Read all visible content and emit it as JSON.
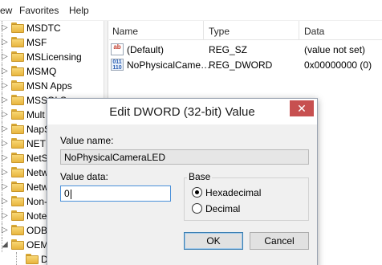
{
  "menu": {
    "items": [
      "ew",
      "Favorites",
      "Help"
    ]
  },
  "tree": {
    "items": [
      {
        "label": "MSDTC",
        "arrow": "▷"
      },
      {
        "label": "MSF",
        "arrow": "▷"
      },
      {
        "label": "MSLicensing",
        "arrow": "▷"
      },
      {
        "label": "MSMQ",
        "arrow": "▷"
      },
      {
        "label": "MSN Apps",
        "arrow": "▷"
      },
      {
        "label": "MSSQLS",
        "arrow": "▷"
      },
      {
        "label": "Mult",
        "arrow": "▷"
      },
      {
        "label": "NapS",
        "arrow": "▷"
      },
      {
        "label": "NET",
        "arrow": "▷"
      },
      {
        "label": "NetS",
        "arrow": "▷"
      },
      {
        "label": "Netw",
        "arrow": "▷"
      },
      {
        "label": "Netw",
        "arrow": "▷"
      },
      {
        "label": "Non-",
        "arrow": "▷"
      },
      {
        "label": "Note",
        "arrow": "▷"
      },
      {
        "label": "ODB",
        "arrow": "▷"
      },
      {
        "label": "OEM",
        "arrow": "◢"
      },
      {
        "label": "D",
        "arrow": ""
      }
    ]
  },
  "list": {
    "columns": [
      "Name",
      "Type",
      "Data"
    ],
    "rows": [
      {
        "icon": "string-value-icon",
        "badge": "ab",
        "name": "(Default)",
        "type": "REG_SZ",
        "data": "(value not set)"
      },
      {
        "icon": "dword-value-icon",
        "badge": "011\n110",
        "name": "NoPhysicalCame…",
        "type": "REG_DWORD",
        "data": "0x00000000 (0)"
      }
    ]
  },
  "dialog": {
    "title": "Edit DWORD (32-bit) Value",
    "close_glyph": "✕",
    "value_name_label": "Value name:",
    "value_name": "NoPhysicalCameraLED",
    "value_data_label": "Value data:",
    "value_data": "0",
    "base_label": "Base",
    "base_options": [
      "Hexadecimal",
      "Decimal"
    ],
    "base_selected": "Hexadecimal",
    "ok_label": "OK",
    "cancel_label": "Cancel"
  }
}
